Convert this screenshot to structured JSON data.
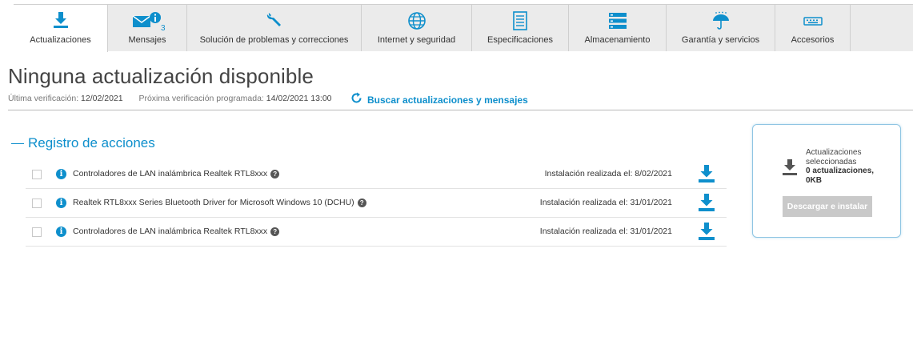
{
  "tabs": [
    {
      "label": "Actualizaciones",
      "icon": "download-icon",
      "active": true
    },
    {
      "label": "Mensajes",
      "icon": "envelope-info-icon",
      "badge": "3"
    },
    {
      "label": "Solución de problemas y correcciones",
      "icon": "wrench-icon"
    },
    {
      "label": "Internet y seguridad",
      "icon": "globe-icon"
    },
    {
      "label": "Especificaciones",
      "icon": "document-icon"
    },
    {
      "label": "Almacenamiento",
      "icon": "storage-stack-icon"
    },
    {
      "label": "Garantía y servicios",
      "icon": "umbrella-icon"
    },
    {
      "label": "Accesorios",
      "icon": "keyboard-icon"
    }
  ],
  "header": {
    "title": "Ninguna actualización disponible",
    "last_check_label": "Última verificación:",
    "last_check_value": "12/02/2021",
    "next_check_label": "Próxima verificación programada:",
    "next_check_value": "14/02/2021 13:00",
    "refresh_label": "Buscar actualizaciones y mensajes"
  },
  "registry": {
    "title": "Registro de acciones",
    "rows": [
      {
        "name": "Controladores de LAN inalámbrica Realtek RTL8xxx",
        "date": "Instalación realizada el: 8/02/2021"
      },
      {
        "name": "Realtek RTL8xxx Series Bluetooth Driver for Microsoft Windows 10 (DCHU)",
        "date": "Instalación realizada el: 31/01/2021"
      },
      {
        "name": "Controladores de LAN inalámbrica Realtek RTL8xxx",
        "date": "Instalación realizada el: 31/01/2021"
      }
    ]
  },
  "panel": {
    "line1": "Actualizaciones",
    "line2": "seleccionadas",
    "count": "0 actualizaciones,",
    "size": "0KB",
    "button": "Descargar e instalar"
  },
  "colors": {
    "accent": "#0e8fcc",
    "tab_bg": "#ebebeb",
    "button_disabled": "#c9c9c9"
  },
  "icons": {
    "info": "i",
    "help": "?"
  }
}
